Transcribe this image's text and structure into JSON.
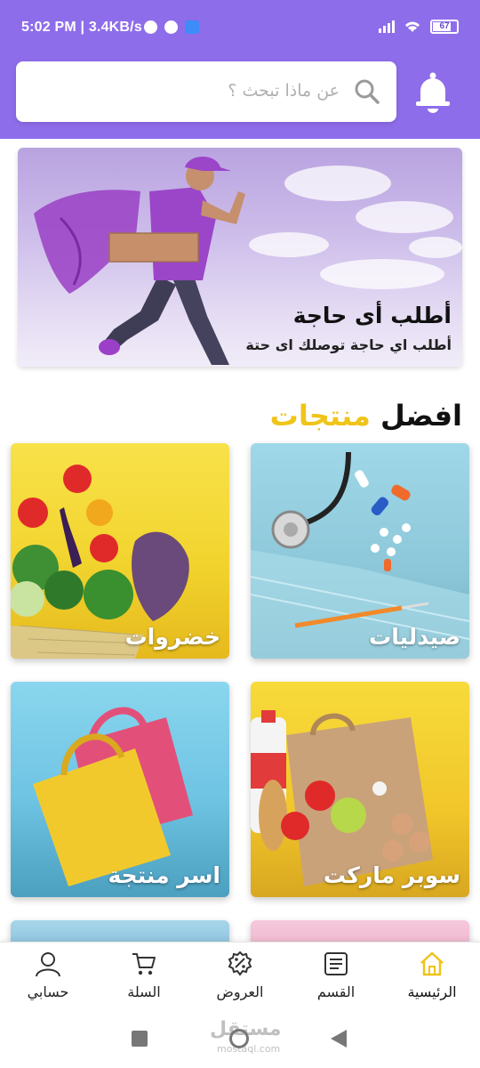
{
  "status_bar": {
    "text": "5:02 PM | 3.4KB/s",
    "battery": "67"
  },
  "header": {
    "search_placeholder": "عن ماذا تبحث ؟",
    "icons": [
      "search-icon",
      "bell-icon"
    ]
  },
  "banner": {
    "title": "أطلب أى حاجة",
    "subtitle": "أطلب اي حاجة توصلك اى حتة"
  },
  "section": {
    "title_part1": "افضل",
    "title_part2": "منتجات"
  },
  "categories": [
    {
      "label": "صيدليات"
    },
    {
      "label": "خضروات"
    },
    {
      "label": "سوبر ماركت"
    },
    {
      "label": "اسر منتجة"
    }
  ],
  "bottom_nav": {
    "items": [
      {
        "label": "الرئيسية",
        "icon": "home-icon",
        "active": true
      },
      {
        "label": "القسم",
        "icon": "list-icon"
      },
      {
        "label": "العروض",
        "icon": "discount-icon"
      },
      {
        "label": "السلة",
        "icon": "cart-icon"
      },
      {
        "label": "حسابي",
        "icon": "user-icon"
      }
    ]
  },
  "watermark": {
    "text": "مستقل",
    "sub": "mostaql.com"
  },
  "colors": {
    "brand_purple": "#8e6dea",
    "accent_yellow": "#f0c419",
    "active_nav": "#f0c419"
  }
}
